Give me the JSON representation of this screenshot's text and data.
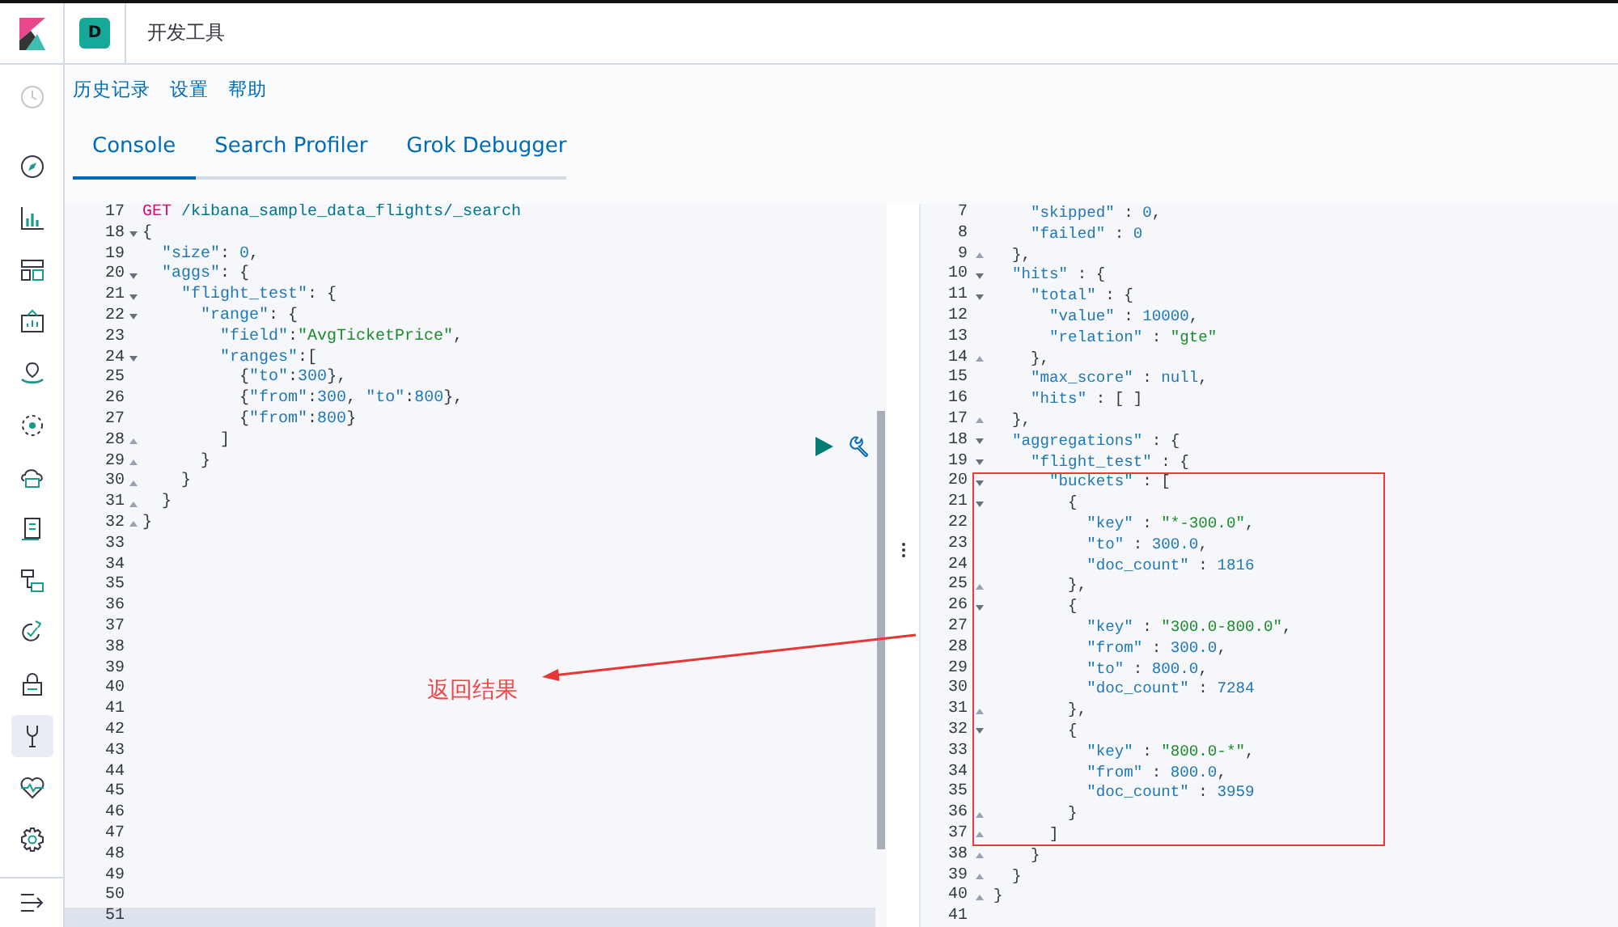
{
  "header": {
    "avatar": "D",
    "title": "开发工具"
  },
  "sidebar": {
    "items": [
      {
        "disabled": true,
        "selected": false
      },
      {
        "disabled": false,
        "selected": false
      },
      {
        "disabled": false,
        "selected": false
      },
      {
        "disabled": false,
        "selected": false
      },
      {
        "disabled": false,
        "selected": false
      },
      {
        "disabled": false,
        "selected": false
      },
      {
        "disabled": false,
        "selected": false
      },
      {
        "disabled": false,
        "selected": false
      },
      {
        "disabled": false,
        "selected": false
      },
      {
        "disabled": false,
        "selected": false
      },
      {
        "disabled": false,
        "selected": false
      },
      {
        "disabled": false,
        "selected": false
      },
      {
        "disabled": false,
        "selected": true
      },
      {
        "disabled": false,
        "selected": false
      },
      {
        "disabled": false,
        "selected": false
      }
    ]
  },
  "menu": [
    "历史记录",
    "设置",
    "帮助"
  ],
  "tabs": [
    {
      "label": "Console",
      "selected": true
    },
    {
      "label": "Search Profiler",
      "selected": false
    },
    {
      "label": "Grok Debugger",
      "selected": false
    }
  ],
  "request": {
    "lines": [
      {
        "num": "17",
        "kind": "plain",
        "active": false,
        "tokens": [
          {
            "kind": "method",
            "text": "GET"
          },
          {
            "kind": "path",
            "text": " /kibana_sample_data_flights/_search"
          }
        ]
      },
      {
        "num": "18",
        "kind": "fold-start",
        "active": false,
        "tokens": [
          {
            "kind": "punct",
            "text": "{"
          }
        ]
      },
      {
        "num": "19",
        "kind": "plain",
        "active": false,
        "tokens": [
          {
            "kind": "key",
            "text": "  \"size\""
          },
          {
            "kind": "punct",
            "text": ": "
          },
          {
            "kind": "num",
            "text": "0"
          },
          {
            "kind": "punct",
            "text": ","
          }
        ]
      },
      {
        "num": "20",
        "kind": "fold-start",
        "active": false,
        "tokens": [
          {
            "kind": "key",
            "text": "  \"aggs\""
          },
          {
            "kind": "punct",
            "text": ": {"
          }
        ]
      },
      {
        "num": "21",
        "kind": "fold-start",
        "active": false,
        "tokens": [
          {
            "kind": "key",
            "text": "    \"flight_test\""
          },
          {
            "kind": "punct",
            "text": ": {"
          }
        ]
      },
      {
        "num": "22",
        "kind": "fold-start",
        "active": false,
        "tokens": [
          {
            "kind": "key",
            "text": "      \"range\""
          },
          {
            "kind": "punct",
            "text": ": {"
          }
        ]
      },
      {
        "num": "23",
        "kind": "plain",
        "active": false,
        "tokens": [
          {
            "kind": "key",
            "text": "        \"field\""
          },
          {
            "kind": "punct",
            "text": ":"
          },
          {
            "kind": "str",
            "text": "\"AvgTicketPrice\""
          },
          {
            "kind": "punct",
            "text": ","
          }
        ]
      },
      {
        "num": "24",
        "kind": "fold-start",
        "active": false,
        "tokens": [
          {
            "kind": "key",
            "text": "        \"ranges\""
          },
          {
            "kind": "punct",
            "text": ":["
          }
        ]
      },
      {
        "num": "25",
        "kind": "plain",
        "active": false,
        "tokens": [
          {
            "kind": "punct",
            "text": "          {"
          },
          {
            "kind": "key",
            "text": "\"to\""
          },
          {
            "kind": "punct",
            "text": ":"
          },
          {
            "kind": "num",
            "text": "300"
          },
          {
            "kind": "punct",
            "text": "},"
          }
        ]
      },
      {
        "num": "26",
        "kind": "plain",
        "active": false,
        "tokens": [
          {
            "kind": "punct",
            "text": "          {"
          },
          {
            "kind": "key",
            "text": "\"from\""
          },
          {
            "kind": "punct",
            "text": ":"
          },
          {
            "kind": "num",
            "text": "300"
          },
          {
            "kind": "punct",
            "text": ", "
          },
          {
            "kind": "key",
            "text": "\"to\""
          },
          {
            "kind": "punct",
            "text": ":"
          },
          {
            "kind": "num",
            "text": "800"
          },
          {
            "kind": "punct",
            "text": "},"
          }
        ]
      },
      {
        "num": "27",
        "kind": "plain",
        "active": false,
        "tokens": [
          {
            "kind": "punct",
            "text": "          {"
          },
          {
            "kind": "key",
            "text": "\"from\""
          },
          {
            "kind": "punct",
            "text": ":"
          },
          {
            "kind": "num",
            "text": "800"
          },
          {
            "kind": "punct",
            "text": "}"
          }
        ]
      },
      {
        "num": "28",
        "kind": "fold-end",
        "active": false,
        "tokens": [
          {
            "kind": "punct",
            "text": "        ]"
          }
        ]
      },
      {
        "num": "29",
        "kind": "fold-end",
        "active": false,
        "tokens": [
          {
            "kind": "punct",
            "text": "      }"
          }
        ]
      },
      {
        "num": "30",
        "kind": "fold-end",
        "active": false,
        "tokens": [
          {
            "kind": "punct",
            "text": "    }"
          }
        ]
      },
      {
        "num": "31",
        "kind": "fold-end",
        "active": false,
        "tokens": [
          {
            "kind": "punct",
            "text": "  }"
          }
        ]
      },
      {
        "num": "32",
        "kind": "fold-end",
        "active": false,
        "tokens": [
          {
            "kind": "punct",
            "text": "}"
          }
        ]
      },
      {
        "num": "33",
        "kind": "plain",
        "active": false
      },
      {
        "num": "34",
        "kind": "plain",
        "active": false
      },
      {
        "num": "35",
        "kind": "plain",
        "active": false
      },
      {
        "num": "36",
        "kind": "plain",
        "active": false
      },
      {
        "num": "37",
        "kind": "plain",
        "active": false
      },
      {
        "num": "38",
        "kind": "plain",
        "active": false
      },
      {
        "num": "39",
        "kind": "plain",
        "active": false
      },
      {
        "num": "40",
        "kind": "plain",
        "active": false
      },
      {
        "num": "41",
        "kind": "plain",
        "active": false
      },
      {
        "num": "42",
        "kind": "plain",
        "active": false
      },
      {
        "num": "43",
        "kind": "plain",
        "active": false
      },
      {
        "num": "44",
        "kind": "plain",
        "active": false
      },
      {
        "num": "45",
        "kind": "plain",
        "active": false
      },
      {
        "num": "46",
        "kind": "plain",
        "active": false
      },
      {
        "num": "47",
        "kind": "plain",
        "active": false
      },
      {
        "num": "48",
        "kind": "plain",
        "active": false
      },
      {
        "num": "49",
        "kind": "plain",
        "active": false
      },
      {
        "num": "50",
        "kind": "plain",
        "active": false
      },
      {
        "num": "51",
        "kind": "plain",
        "active": true
      }
    ]
  },
  "response": {
    "lines": [
      {
        "num": "7",
        "kind": "plain",
        "tokens": [
          {
            "kind": "key",
            "text": "    \"skipped\""
          },
          {
            "kind": "punct",
            "text": " : "
          },
          {
            "kind": "num",
            "text": "0"
          },
          {
            "kind": "punct",
            "text": ","
          }
        ]
      },
      {
        "num": "8",
        "kind": "plain",
        "tokens": [
          {
            "kind": "key",
            "text": "    \"failed\""
          },
          {
            "kind": "punct",
            "text": " : "
          },
          {
            "kind": "num",
            "text": "0"
          }
        ]
      },
      {
        "num": "9",
        "kind": "fold-end",
        "tokens": [
          {
            "kind": "punct",
            "text": "  },"
          }
        ]
      },
      {
        "num": "10",
        "kind": "fold-start",
        "tokens": [
          {
            "kind": "key",
            "text": "  \"hits\""
          },
          {
            "kind": "punct",
            "text": " : {"
          }
        ]
      },
      {
        "num": "11",
        "kind": "fold-start",
        "tokens": [
          {
            "kind": "key",
            "text": "    \"total\""
          },
          {
            "kind": "punct",
            "text": " : {"
          }
        ]
      },
      {
        "num": "12",
        "kind": "plain",
        "tokens": [
          {
            "kind": "key",
            "text": "      \"value\""
          },
          {
            "kind": "punct",
            "text": " : "
          },
          {
            "kind": "num",
            "text": "10000"
          },
          {
            "kind": "punct",
            "text": ","
          }
        ]
      },
      {
        "num": "13",
        "kind": "plain",
        "tokens": [
          {
            "kind": "key",
            "text": "      \"relation\""
          },
          {
            "kind": "punct",
            "text": " : "
          },
          {
            "kind": "str",
            "text": "\"gte\""
          }
        ]
      },
      {
        "num": "14",
        "kind": "fold-end",
        "tokens": [
          {
            "kind": "punct",
            "text": "    },"
          }
        ]
      },
      {
        "num": "15",
        "kind": "plain",
        "tokens": [
          {
            "kind": "key",
            "text": "    \"max_score\""
          },
          {
            "kind": "punct",
            "text": " : "
          },
          {
            "kind": "num",
            "text": "null"
          },
          {
            "kind": "punct",
            "text": ","
          }
        ]
      },
      {
        "num": "16",
        "kind": "plain",
        "tokens": [
          {
            "kind": "key",
            "text": "    \"hits\""
          },
          {
            "kind": "punct",
            "text": " : [ ]"
          }
        ]
      },
      {
        "num": "17",
        "kind": "fold-end",
        "tokens": [
          {
            "kind": "punct",
            "text": "  },"
          }
        ]
      },
      {
        "num": "18",
        "kind": "fold-start",
        "tokens": [
          {
            "kind": "key",
            "text": "  \"aggregations\""
          },
          {
            "kind": "punct",
            "text": " : {"
          }
        ]
      },
      {
        "num": "19",
        "kind": "fold-start",
        "tokens": [
          {
            "kind": "key",
            "text": "    \"flight_test\""
          },
          {
            "kind": "punct",
            "text": " : {"
          }
        ]
      },
      {
        "num": "20",
        "kind": "fold-start",
        "tokens": [
          {
            "kind": "key",
            "text": "      \"buckets\""
          },
          {
            "kind": "punct",
            "text": " : ["
          }
        ]
      },
      {
        "num": "21",
        "kind": "fold-start",
        "tokens": [
          {
            "kind": "punct",
            "text": "        {"
          }
        ]
      },
      {
        "num": "22",
        "kind": "plain",
        "tokens": [
          {
            "kind": "key",
            "text": "          \"key\""
          },
          {
            "kind": "punct",
            "text": " : "
          },
          {
            "kind": "str",
            "text": "\"*-300.0\""
          },
          {
            "kind": "punct",
            "text": ","
          }
        ]
      },
      {
        "num": "23",
        "kind": "plain",
        "tokens": [
          {
            "kind": "key",
            "text": "          \"to\""
          },
          {
            "kind": "punct",
            "text": " : "
          },
          {
            "kind": "num",
            "text": "300.0"
          },
          {
            "kind": "punct",
            "text": ","
          }
        ]
      },
      {
        "num": "24",
        "kind": "plain",
        "tokens": [
          {
            "kind": "key",
            "text": "          \"doc_count\""
          },
          {
            "kind": "punct",
            "text": " : "
          },
          {
            "kind": "num",
            "text": "1816"
          }
        ]
      },
      {
        "num": "25",
        "kind": "fold-end",
        "tokens": [
          {
            "kind": "punct",
            "text": "        },"
          }
        ]
      },
      {
        "num": "26",
        "kind": "fold-start",
        "tokens": [
          {
            "kind": "punct",
            "text": "        {"
          }
        ]
      },
      {
        "num": "27",
        "kind": "plain",
        "tokens": [
          {
            "kind": "key",
            "text": "          \"key\""
          },
          {
            "kind": "punct",
            "text": " : "
          },
          {
            "kind": "str",
            "text": "\"300.0-800.0\""
          },
          {
            "kind": "punct",
            "text": ","
          }
        ]
      },
      {
        "num": "28",
        "kind": "plain",
        "tokens": [
          {
            "kind": "key",
            "text": "          \"from\""
          },
          {
            "kind": "punct",
            "text": " : "
          },
          {
            "kind": "num",
            "text": "300.0"
          },
          {
            "kind": "punct",
            "text": ","
          }
        ]
      },
      {
        "num": "29",
        "kind": "plain",
        "tokens": [
          {
            "kind": "key",
            "text": "          \"to\""
          },
          {
            "kind": "punct",
            "text": " : "
          },
          {
            "kind": "num",
            "text": "800.0"
          },
          {
            "kind": "punct",
            "text": ","
          }
        ]
      },
      {
        "num": "30",
        "kind": "plain",
        "tokens": [
          {
            "kind": "key",
            "text": "          \"doc_count\""
          },
          {
            "kind": "punct",
            "text": " : "
          },
          {
            "kind": "num",
            "text": "7284"
          }
        ]
      },
      {
        "num": "31",
        "kind": "fold-end",
        "tokens": [
          {
            "kind": "punct",
            "text": "        },"
          }
        ]
      },
      {
        "num": "32",
        "kind": "fold-start",
        "tokens": [
          {
            "kind": "punct",
            "text": "        {"
          }
        ]
      },
      {
        "num": "33",
        "kind": "plain",
        "tokens": [
          {
            "kind": "key",
            "text": "          \"key\""
          },
          {
            "kind": "punct",
            "text": " : "
          },
          {
            "kind": "str",
            "text": "\"800.0-*\""
          },
          {
            "kind": "punct",
            "text": ","
          }
        ]
      },
      {
        "num": "34",
        "kind": "plain",
        "tokens": [
          {
            "kind": "key",
            "text": "          \"from\""
          },
          {
            "kind": "punct",
            "text": " : "
          },
          {
            "kind": "num",
            "text": "800.0"
          },
          {
            "kind": "punct",
            "text": ","
          }
        ]
      },
      {
        "num": "35",
        "kind": "plain",
        "tokens": [
          {
            "kind": "key",
            "text": "          \"doc_count\""
          },
          {
            "kind": "punct",
            "text": " : "
          },
          {
            "kind": "num",
            "text": "3959"
          }
        ]
      },
      {
        "num": "36",
        "kind": "fold-end",
        "tokens": [
          {
            "kind": "punct",
            "text": "        }"
          }
        ]
      },
      {
        "num": "37",
        "kind": "fold-end",
        "tokens": [
          {
            "kind": "punct",
            "text": "      ]"
          }
        ]
      },
      {
        "num": "38",
        "kind": "fold-end",
        "tokens": [
          {
            "kind": "punct",
            "text": "    }"
          }
        ]
      },
      {
        "num": "39",
        "kind": "fold-end",
        "tokens": [
          {
            "kind": "punct",
            "text": "  }"
          }
        ]
      },
      {
        "num": "40",
        "kind": "fold-end",
        "tokens": [
          {
            "kind": "punct",
            "text": "}"
          }
        ]
      },
      {
        "num": "41",
        "kind": "plain"
      }
    ]
  },
  "annotation": {
    "text": "返回结果"
  }
}
